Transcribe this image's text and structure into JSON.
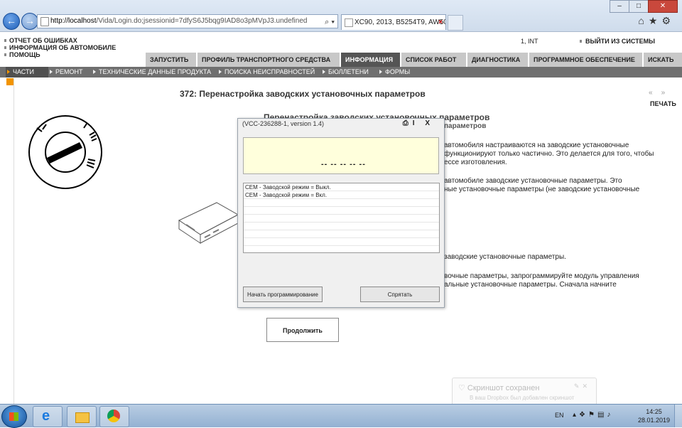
{
  "browser": {
    "address_host": "http://localhost",
    "address_path": "/Vida/Login.do;jsessionid=7dfyS6J5bqg9IAD8o3pMVpJ3.undefined",
    "address_controls": "⌕ ▾",
    "tab_title": "XC90, 2013, B5254T9, AW50...",
    "tab_close": "×"
  },
  "vida": {
    "menu": [
      "ОТЧЕТ ОБ ОШИБКАХ",
      "ИНФОРМАЦИЯ ОБ АВТОМОБИЛЕ",
      "ПОМОЩЬ"
    ],
    "user": "1, INT",
    "logout": "ВЫЙТИ ИЗ СИСТЕМЫ",
    "main_tabs": [
      "ЗАПУСТИТЬ",
      "ПРОФИЛЬ ТРАНСПОРТНОГО СРЕДСТВА",
      "ИНФОРМАЦИЯ",
      "СПИСОК РАБОТ",
      "ДИАГНОСТИКА",
      "ПРОГРАММНОЕ ОБЕСПЕЧЕНИЕ",
      "ИСКАТЬ"
    ],
    "sub_tabs": [
      "ЧАСТИ",
      "РЕМОНТ",
      "ТЕХНИЧЕСКИЕ ДАННЫЕ ПРОДУКТА",
      "ПОИСКА НЕИСПРАВНОСТЕЙ",
      "БЮЛЛЕТЕНИ",
      "ФОРМЫ"
    ]
  },
  "doc": {
    "title": "372: Перенастройка заводских установочных параметров",
    "print": "ПЕЧАТЬ",
    "heading": "Перенастройка заводских установочных параметров",
    "subheading": "параметров",
    "p1_l1": "автомобиля настраиваются на заводские установочные",
    "p1_l2": "функционируют только частично. Это делается для того, чтобы",
    "p1_l3": "ессе изготовления.",
    "p2_l1": "автомобиле заводские установочные параметры. Это",
    "p2_l2": "ные установочные параметры (не заводские установочные",
    "p3_l1": "заводские установочные параметры.",
    "p4_l1": "вочные параметры, запрограммируйте модуль управления",
    "p4_l2": "альные установочные параметры. Сначала начните",
    "continue": "Продолжить"
  },
  "dialog": {
    "title": "(VCC-236288-1, version 1.4)",
    "controls": "I X",
    "display": "-- -- -- -- --",
    "list": [
      "CEM - Заводской режим = Выкл.",
      "CEM - Заводской режим = Вкл."
    ],
    "btn_program": "Начать программирование",
    "btn_hide": "Спрятать"
  },
  "taskbar": {
    "lang": "EN",
    "time": "14:25",
    "date": "28.01.2019"
  },
  "toast": {
    "title": "Скриншот сохранен",
    "message": "В ваш Dropbox был добавлен скриншот"
  }
}
